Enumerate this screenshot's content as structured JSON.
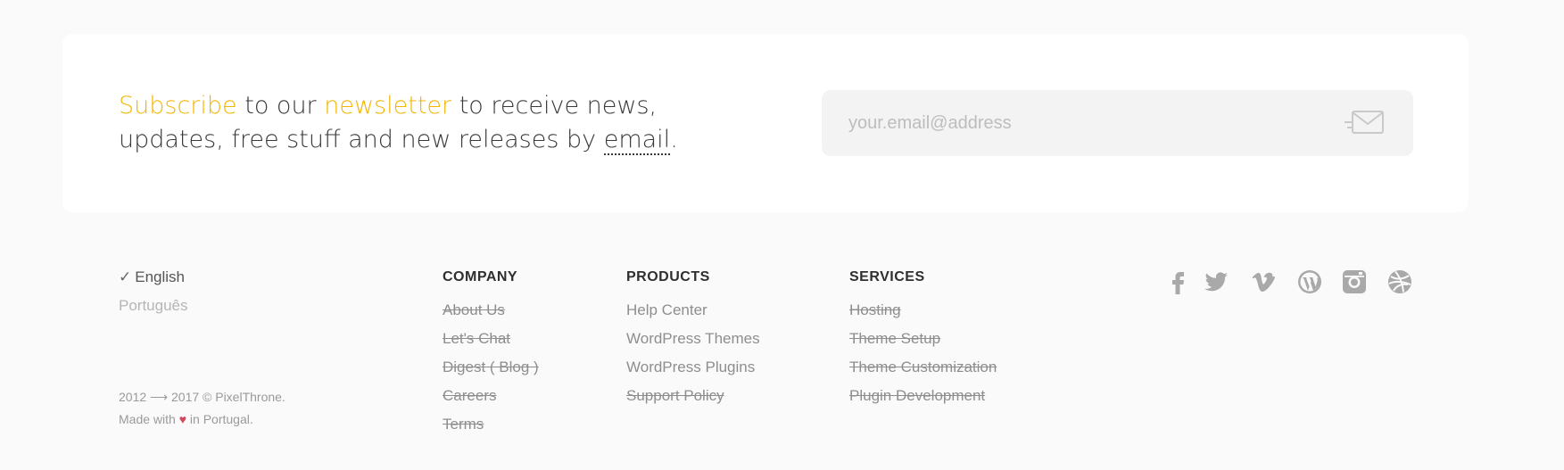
{
  "newsletter": {
    "word_subscribe": "Subscribe",
    "text_1": " to our ",
    "word_newsletter": "newsletter",
    "text_2": " to receive news, updates, free stuff and new releases by ",
    "word_email": "email",
    "text_3": ".",
    "input_placeholder": "your.email@address",
    "input_value": "",
    "send_icon": "envelope-send-icon",
    "accent_color": "#f2b705"
  },
  "languages": {
    "current_check": "✓",
    "current": "English",
    "other": "Português"
  },
  "copyright": {
    "line1": "2012 ⟶ 2017 © PixelThrone.",
    "line2_pre": "Made with ",
    "heart": "♥",
    "line2_post": " in Portugal."
  },
  "columns": [
    {
      "heading": "COMPANY",
      "items": [
        "About Us",
        "Let's Chat",
        "Digest ( Blog )",
        "Careers",
        "Terms"
      ]
    },
    {
      "heading": "PRODUCTS",
      "items": [
        "Help Center",
        "WordPress Themes",
        "WordPress Plugins",
        "Support Policy"
      ]
    },
    {
      "heading": "SERVICES",
      "items": [
        "Hosting",
        "Theme Setup",
        "Theme Customization",
        "Plugin Development"
      ]
    }
  ],
  "social": [
    "facebook-icon",
    "twitter-icon",
    "vimeo-icon",
    "wordpress-icon",
    "instagram-icon",
    "dribbble-icon"
  ]
}
